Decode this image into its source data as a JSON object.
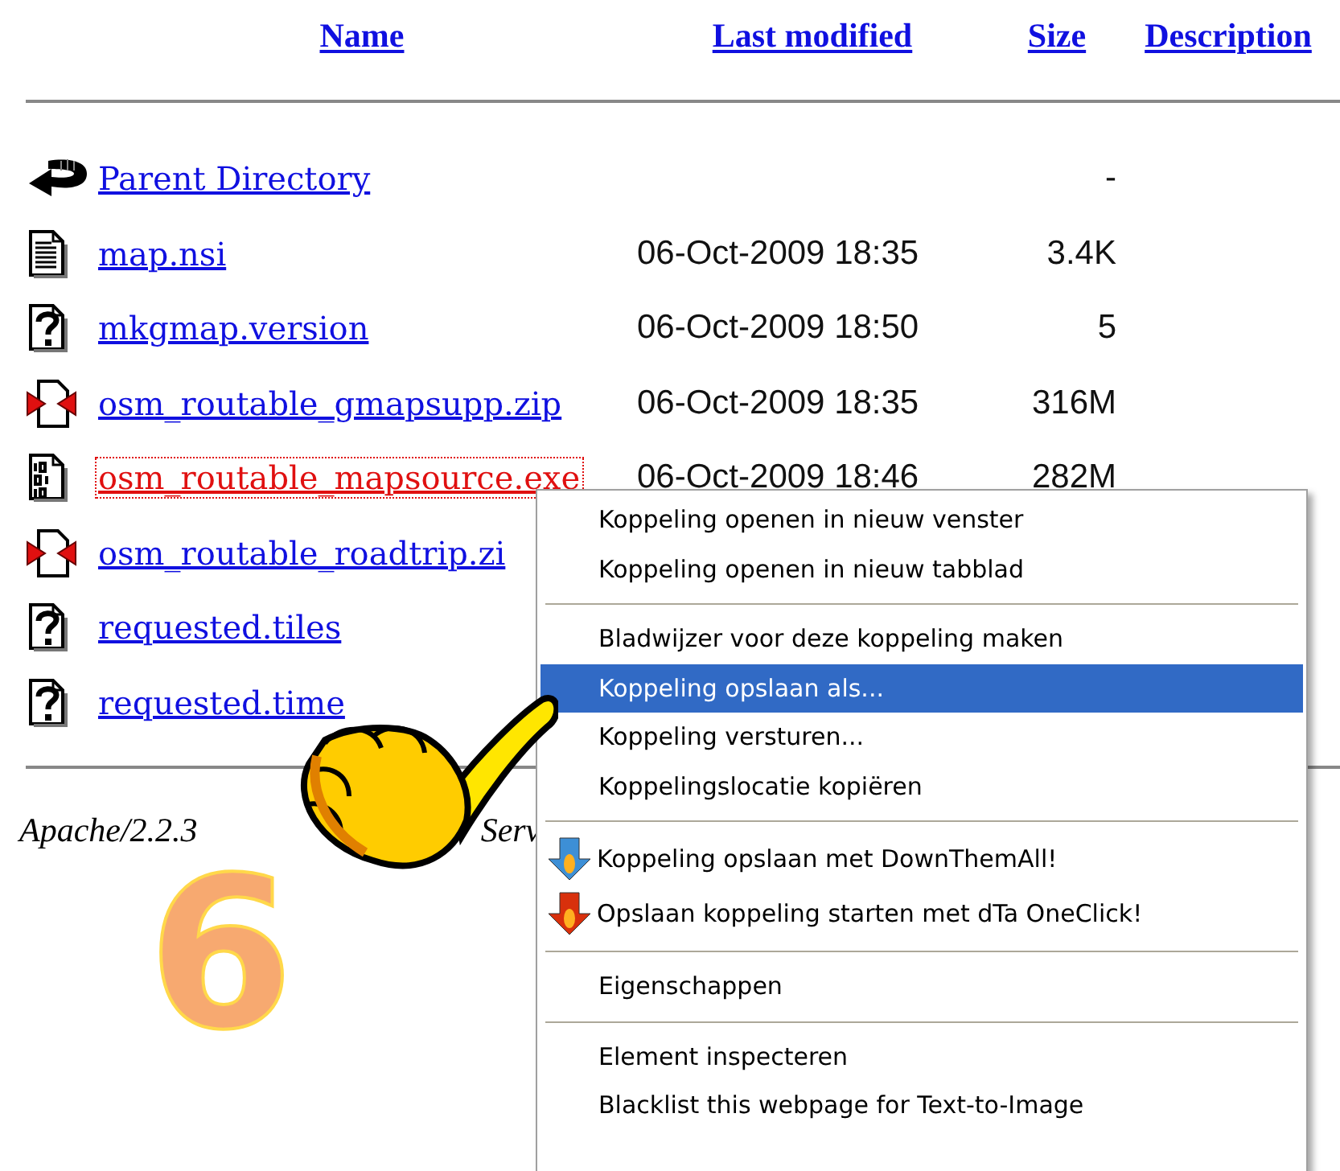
{
  "table": {
    "columns": [
      "Name",
      "Last modified",
      "Size",
      "Description"
    ],
    "rows": [
      {
        "kind": "back",
        "name": "Parent Directory",
        "modified": "",
        "size": "-",
        "active": false
      },
      {
        "kind": "text",
        "name": "map.nsi",
        "modified": "06-Oct-2009 18:35",
        "size": "3.4K",
        "active": false
      },
      {
        "kind": "unknown",
        "name": "mkgmap.version",
        "modified": "06-Oct-2009 18:50",
        "size": "5",
        "active": false
      },
      {
        "kind": "compressed",
        "name": "osm_routable_gmapsupp.zip",
        "modified": "06-Oct-2009 18:35",
        "size": "316M",
        "active": false
      },
      {
        "kind": "binary",
        "name": "osm_routable_mapsource.exe",
        "modified": "06-Oct-2009 18:46",
        "size": "282M",
        "active": true
      },
      {
        "kind": "compressed",
        "name": "osm_routable_roadtrip.zi",
        "modified": "",
        "size": "",
        "active": false
      },
      {
        "kind": "unknown",
        "name": "requested.tiles",
        "modified": "",
        "size": "",
        "active": false
      },
      {
        "kind": "unknown",
        "name": "requested.time",
        "modified": "",
        "size": "",
        "active": false
      }
    ]
  },
  "footer": [
    "Apache/2.2.3",
    "Serv"
  ],
  "annotation": "6",
  "context_menu": [
    {
      "kind": "item",
      "label": "Koppeling openen in nieuw venster",
      "selected": false
    },
    {
      "kind": "item",
      "label": "Koppeling openen in nieuw tabblad",
      "selected": false
    },
    {
      "kind": "separator"
    },
    {
      "kind": "item",
      "label": "Bladwijzer voor deze koppeling maken",
      "selected": false
    },
    {
      "kind": "item",
      "label": "Koppeling opslaan als...",
      "selected": true
    },
    {
      "kind": "item",
      "label": "Koppeling versturen...",
      "selected": false
    },
    {
      "kind": "item",
      "label": "Koppelingslocatie kopiëren",
      "selected": false
    },
    {
      "kind": "separator"
    },
    {
      "kind": "arrow-item",
      "label": "Koppeling opslaan met DownThemAll!",
      "selected": false,
      "color": "#3d8fd6"
    },
    {
      "kind": "arrow-item",
      "label": "Opslaan koppeling starten met dTa OneClick!",
      "selected": false,
      "color": "#d8300c"
    },
    {
      "kind": "separator"
    },
    {
      "kind": "item",
      "label": "Eigenschappen",
      "selected": false
    },
    {
      "kind": "separator"
    },
    {
      "kind": "item",
      "label": "Element inspecteren",
      "selected": false
    },
    {
      "kind": "item",
      "label": "Blacklist this webpage for Text-to-Image",
      "selected": false
    }
  ]
}
